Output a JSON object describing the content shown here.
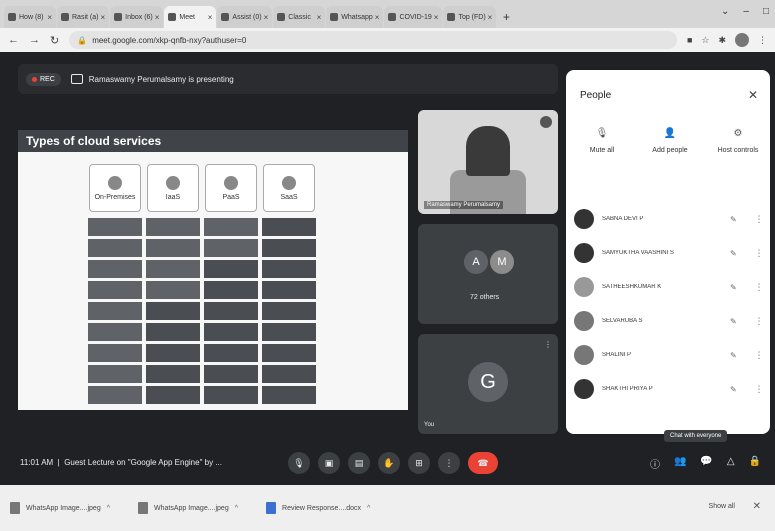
{
  "browser": {
    "tabs": [
      {
        "label": "How (8)"
      },
      {
        "label": "Rasit (a)"
      },
      {
        "label": "Inbox (6)"
      },
      {
        "label": "Meet"
      },
      {
        "label": "Assist (0)"
      },
      {
        "label": "Classic"
      },
      {
        "label": "Whatsapp"
      },
      {
        "label": "COVID-19"
      },
      {
        "label": "Top (FD)"
      }
    ],
    "url": "meet.google.com/xkp-qnfb-nxy?authuser=0"
  },
  "meet": {
    "rec_label": "REC",
    "presenter_text": "Ramaswamy Perumalsamy is presenting",
    "slide": {
      "title": "Types of cloud services",
      "columns": [
        {
          "label": "On-Premises"
        },
        {
          "label": "IaaS"
        },
        {
          "label": "PaaS"
        },
        {
          "label": "SaaS"
        }
      ]
    },
    "tiles": {
      "presenter_name": "Ramaswamy Perumalsamy",
      "others_a": "A",
      "others_m": "M",
      "others_label": "72 others",
      "self_initial": "G",
      "self_label": "You"
    },
    "people_panel": {
      "title": "People",
      "actions": [
        {
          "label": "Mute all",
          "icon": "mute-icon"
        },
        {
          "label": "Add people",
          "icon": "add-person-icon"
        },
        {
          "label": "Host controls",
          "icon": "host-controls-icon"
        }
      ],
      "participants": [
        {
          "name": "SABNA DEVI P"
        },
        {
          "name": "SAMYUKTHA VAASHINI S"
        },
        {
          "name": "SATHEESHKUMAR K"
        },
        {
          "name": "SELVARUBA S"
        },
        {
          "name": "SHALINI P"
        },
        {
          "name": "SHAKTHI PRIYA P"
        }
      ],
      "tooltip": "Chat with everyone"
    },
    "bottom": {
      "time": "11:01 AM",
      "meeting_title": "Guest Lecture on \"Google App Engine\" by ..."
    }
  },
  "downloads": {
    "items": [
      {
        "name": "WhatsApp Image....jpeg"
      },
      {
        "name": "WhatsApp Image....jpeg"
      },
      {
        "name": "Review Response....docx"
      }
    ],
    "show_all": "Show all"
  },
  "colors": {
    "meet_bg": "#202124",
    "hangup": "#ea4335",
    "avatar_a": "#5f6368",
    "avatar_m": "#8c8c8c"
  }
}
